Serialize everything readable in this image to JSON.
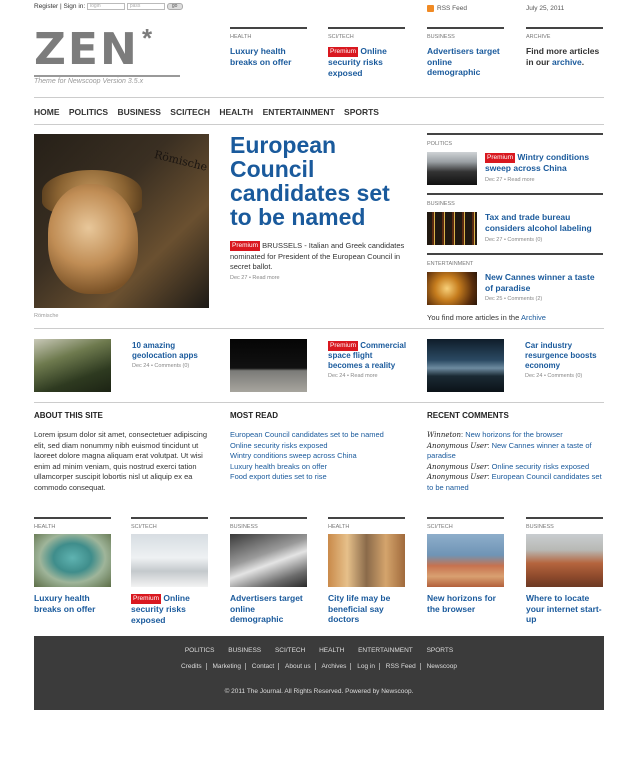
{
  "topbar": {
    "register": "Register",
    "sign_in": "Sign in:",
    "login_placeholder": "login",
    "pass_placeholder": "pass",
    "go": "go"
  },
  "rss_label": "RSS Feed",
  "date": "July 25, 2011",
  "logo": {
    "word": "ZEN",
    "star": "*",
    "tagline": "Theme for Newscoop Version 3.5.x"
  },
  "header_teasers": [
    {
      "cat": "HEALTH",
      "title": "Luxury health breaks on offer",
      "premium": false
    },
    {
      "cat": "SCI/TECH",
      "title": "Online security risks exposed",
      "premium": true
    },
    {
      "cat": "BUSINESS",
      "title": "Advertisers target online demographic",
      "premium": false
    },
    {
      "cat": "ARCHIVE",
      "text_pre": "Find more articles in our ",
      "link": "archive",
      "text_post": "."
    }
  ],
  "premium_label": "Premium",
  "nav": [
    "HOME",
    "POLITICS",
    "BUSINESS",
    "SCI/TECH",
    "HEALTH",
    "ENTERTAINMENT",
    "SPORTS"
  ],
  "lead": {
    "image_text": "Römische",
    "caption": "Römische",
    "title": "European Council candidates set to be named",
    "summary": "BRUSSELS - Italian and Greek candidates nominated for President of the European Council in secret ballot.",
    "meta": "Dec 27 • Read more"
  },
  "side_stories": [
    {
      "cat": "POLITICS",
      "title": "Wintry conditions sweep across China",
      "premium": true,
      "meta": "Dec 27 • Read more"
    },
    {
      "cat": "BUSINESS",
      "title": "Tax and trade bureau considers alcohol labeling",
      "premium": false,
      "meta": "Dec 27 • Comments (0)"
    },
    {
      "cat": "ENTERTAINMENT",
      "title": "New Cannes winner a taste of paradise",
      "premium": false,
      "meta": "Dec 25 • Comments (2)"
    }
  ],
  "archive_line": {
    "pre": "You find more articles in the ",
    "link": "Archive"
  },
  "row4": [
    {
      "title": "10 amazing geolocation apps",
      "premium": false,
      "meta": "Dec 24 • Comments (0)"
    },
    {
      "title": "Commercial space flight becomes a reality",
      "premium": true,
      "meta": "Dec 24 • Read more"
    },
    {
      "title": "Car industry resurgence boosts economy",
      "premium": false,
      "meta": "Dec 24 • Comments (0)"
    }
  ],
  "about": {
    "heading": "ABOUT THIS SITE",
    "text": "Lorem ipsum dolor sit amet, consectetuer adipiscing elit, sed diam nonummy nibh euismod tincidunt ut laoreet dolore magna aliquam erat volutpat. Ut wisi enim ad minim veniam, quis nostrud exerci tation ullamcorper suscipit lobortis nisl ut aliquip ex ea commodo consequat."
  },
  "most_read": {
    "heading": "MOST READ",
    "items": [
      "European Council candidates set to be named",
      "Online security risks exposed",
      "Wintry conditions sweep across China",
      "Luxury health breaks on offer",
      "Food export duties set to rise"
    ]
  },
  "recent_comments": {
    "heading": "RECENT COMMENTS",
    "items": [
      {
        "author": "Winneton",
        "text": "New horizons for the browser"
      },
      {
        "author": "Anonymous User",
        "text": "New Cannes winner a taste of paradise"
      },
      {
        "author": "Anonymous User",
        "text": "Online security risks exposed"
      },
      {
        "author": "Anonymous User",
        "text": "European Council candidates set to be named"
      }
    ]
  },
  "bottom_grid": [
    {
      "cat": "HEALTH",
      "title": "Luxury health breaks on offer",
      "premium": false
    },
    {
      "cat": "SCI/TECH",
      "title": "Online security risks exposed",
      "premium": true
    },
    {
      "cat": "BUSINESS",
      "title": "Advertisers target online demographic",
      "premium": false
    },
    {
      "cat": "HEALTH",
      "title": "City life may be beneficial say doctors",
      "premium": false
    },
    {
      "cat": "SCI/TECH",
      "title": "New horizons for the browser",
      "premium": false
    },
    {
      "cat": "BUSINESS",
      "title": "Where to locate your internet start-up",
      "premium": false
    }
  ],
  "footer": {
    "nav": [
      "POLITICS",
      "BUSINESS",
      "SCI/TECH",
      "HEALTH",
      "ENTERTAINMENT",
      "SPORTS"
    ],
    "links": [
      "Credits",
      "Marketing",
      "Contact",
      "About us",
      "Archives",
      "Log in",
      "RSS Feed",
      "Newscoop"
    ],
    "copyright": "© 2011 The Journal. All Rights Reserved. Powered by Newscoop."
  },
  "colors": {
    "link": "#1a5a9c",
    "premium": "#d9181f",
    "footer_bg": "#3b3b3b"
  }
}
